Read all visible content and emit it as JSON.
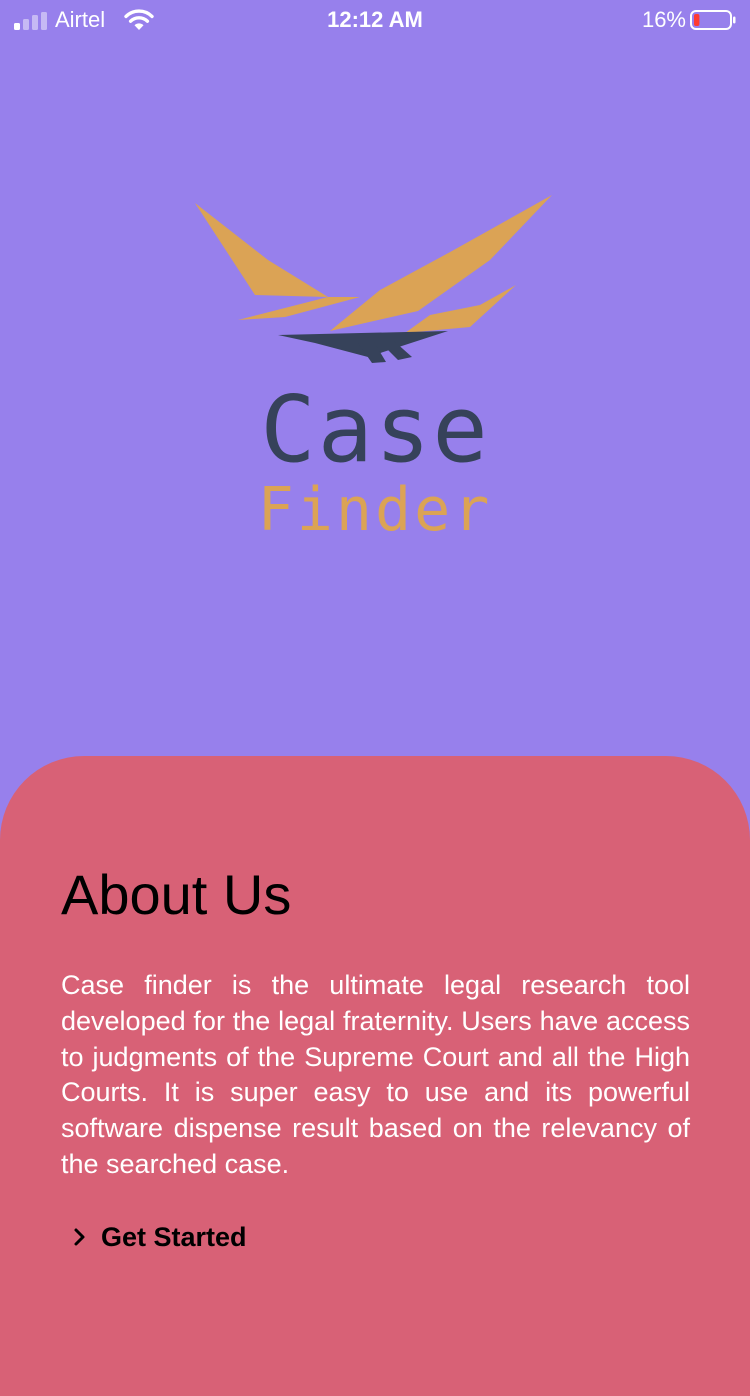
{
  "status_bar": {
    "carrier": "Airtel",
    "time": "12:12 AM",
    "battery_percent": "16%",
    "battery_level": 0.16
  },
  "brand": {
    "name_line1": "Case",
    "name_line2": "Finder",
    "colors": {
      "dark": "#36425a",
      "gold": "#dba355"
    }
  },
  "about": {
    "title": "About Us",
    "body": "Case finder is the ultimate legal research tool developed for the legal fraternity. Users have access to judgments of the Supreme Court and all the High Courts. It is super easy to use and its powerful software dispense result based on the relevancy of the searched case.",
    "cta_label": "Get Started",
    "cta_icon": "chevron-right-icon"
  },
  "colors": {
    "background": "#9780ec",
    "card": "#d86176"
  }
}
